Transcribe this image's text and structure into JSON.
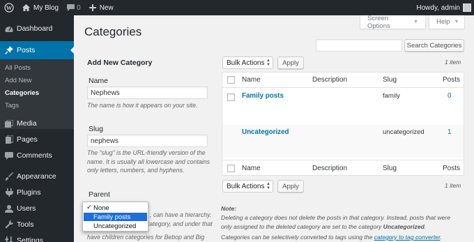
{
  "admin_bar": {
    "site_name": "My Blog",
    "comments_count": "0",
    "new_label": "New",
    "greeting": "Howdy, admin",
    "icons": [
      "wordpress-logo-icon",
      "home-icon",
      "comment-bubble-icon",
      "plus-icon",
      "avatar-icon"
    ]
  },
  "sidebar": {
    "items": [
      {
        "label": "Dashboard",
        "icon": "dashboard-gauge-icon"
      },
      {
        "label": "Posts",
        "icon": "pushpin-icon"
      },
      {
        "label": "Media",
        "icon": "media-icon"
      },
      {
        "label": "Pages",
        "icon": "pages-icon"
      },
      {
        "label": "Comments",
        "icon": "comments-icon"
      },
      {
        "label": "Appearance",
        "icon": "paintbrush-icon"
      },
      {
        "label": "Plugins",
        "icon": "plugin-icon"
      },
      {
        "label": "Users",
        "icon": "users-icon"
      },
      {
        "label": "Tools",
        "icon": "wrench-icon"
      },
      {
        "label": "Settings",
        "icon": "settings-icon"
      }
    ],
    "submenu": [
      "All Posts",
      "Add New",
      "Categories",
      "Tags"
    ],
    "current_item": "Posts",
    "current_submenu": "Categories"
  },
  "page": {
    "title": "Categories",
    "screen_options": "Screen Options",
    "help": "Help"
  },
  "form": {
    "title": "Add New Category",
    "name_label": "Name",
    "name_value": "Nephews",
    "name_desc": "The name is how it appears on your site.",
    "slug_label": "Slug",
    "slug_value": "nephews",
    "slug_desc_1": "The “slug” is the URL-friendly version of the",
    "slug_desc_2": "name. It is usually all lowercase and contains",
    "slug_desc_3": "only letters, numbers, and hyphens.",
    "parent_label": "Parent",
    "parent_desc_1": ", can have a hierarchy.",
    "parent_desc_2": "category, and under that",
    "parent_desc_3": "have children categories for Bebop and Big",
    "parent_options": [
      "None",
      "Family posts",
      "Uncategorized"
    ],
    "parent_checked": "None",
    "parent_highlighted": "Family posts"
  },
  "list": {
    "search_button": "Search Categories",
    "bulk_actions": "Bulk Actions",
    "apply": "Apply",
    "count": "1 item",
    "columns": {
      "name": "Name",
      "description": "Description",
      "slug": "Slug",
      "posts": "Posts"
    },
    "rows": [
      {
        "name": "Family posts",
        "description": "",
        "slug": "family",
        "posts": "0"
      },
      {
        "name": "Uncategorized",
        "description": "",
        "slug": "uncategorized",
        "posts": "1"
      }
    ]
  },
  "note": {
    "heading": "Note:",
    "line1": "Deleting a category does not delete the posts in that category. Instead, posts that were",
    "line2_prefix": "only assigned to the deleted category are set to the category ",
    "line2_bold": "Uncategorized",
    "line2_suffix": ".",
    "line3_prefix": "Categories can be selectively converted to tags using the ",
    "line3_link": "category to tag converter",
    "line3_suffix": "."
  },
  "colors": {
    "admin_bar": "#23282d",
    "accent": "#0073aa",
    "background": "#f1f1f1",
    "submenu_bg": "#32373c",
    "highlight": "#1e6fd9"
  }
}
